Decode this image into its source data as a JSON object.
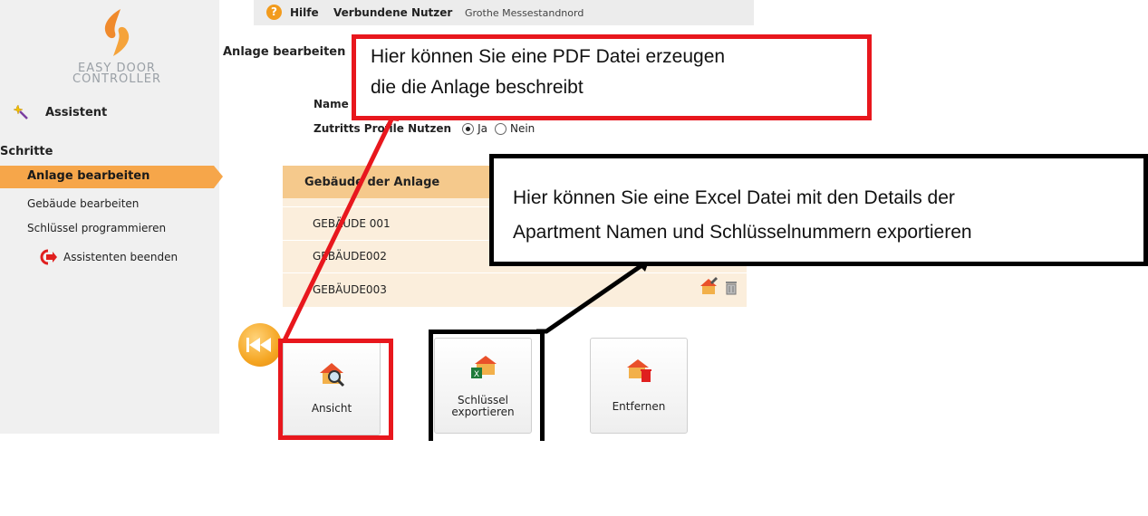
{
  "logo": {
    "line1": "EASY DOOR",
    "line2": "CONTROLLER"
  },
  "sidebar": {
    "assistant": "Assistent",
    "steps_heading": "Schritte",
    "steps": [
      {
        "label": "Anlage bearbeiten",
        "active": true
      },
      {
        "label": "Gebäude bearbeiten",
        "active": false
      },
      {
        "label": "Schlüssel programmieren",
        "active": false
      }
    ],
    "exit": "Assistenten beenden"
  },
  "topbar": {
    "help": "Hilfe",
    "users_label": "Verbundene Nutzer",
    "users_value": "Grothe Messestandnord"
  },
  "main": {
    "title": "Anlage bearbeiten",
    "name_label": "Name d",
    "profile_label": "Zutritts Profile Nutzen",
    "radio_yes": "Ja",
    "radio_no": "Nein",
    "radio_selected": "Ja",
    "table_header": "Gebäude der Anlage",
    "buildings": [
      "GEBÄUDE 001",
      "GEBÄUDE002",
      "GEBÄUDE003"
    ]
  },
  "actions": {
    "view": "Ansicht",
    "export_line1": "Schlüssel",
    "export_line2": "exportieren",
    "delete": "Entfernen"
  },
  "callouts": {
    "pdf_line1": "Hier können Sie eine PDF Datei erzeugen",
    "pdf_line2": "die die Anlage beschreibt",
    "excel_line1": "Hier können Sie eine Excel Datei mit den Details der",
    "excel_line2": "Apartment Namen und Schlüsselnummern  exportieren"
  },
  "colors": {
    "accent": "#f6a64a",
    "callout_red": "#e8171d",
    "callout_black": "#000000",
    "table_header": "#f5c98c",
    "table_body": "#fbeedc"
  }
}
